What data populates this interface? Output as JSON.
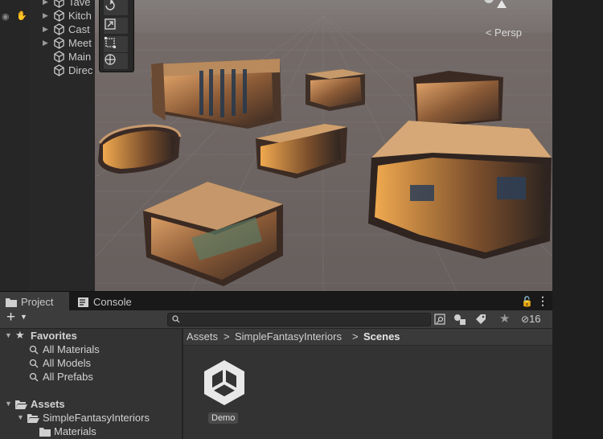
{
  "hierarchy": {
    "items": [
      {
        "label": "Tave",
        "has_children": true
      },
      {
        "label": "Kitch",
        "has_children": true
      },
      {
        "label": "Cast",
        "has_children": true
      },
      {
        "label": "Meet",
        "has_children": true
      },
      {
        "label": "Main",
        "has_children": false
      },
      {
        "label": "Direc",
        "has_children": false
      }
    ]
  },
  "scene": {
    "projection_label": "Persp",
    "tools": [
      "rotate-tool",
      "scale-tool",
      "rect-tool",
      "transform-tool"
    ]
  },
  "bottom_panel": {
    "tabs": [
      {
        "label": "Project",
        "icon": "folder-icon",
        "active": true
      },
      {
        "label": "Console",
        "icon": "console-icon",
        "active": false
      }
    ],
    "add_label": "+",
    "search": {
      "value": "",
      "placeholder": ""
    },
    "hidden_packages_count": "16",
    "favorites": {
      "label": "Favorites",
      "items": [
        "All Materials",
        "All Models",
        "All Prefabs"
      ]
    },
    "assets_tree": {
      "label": "Assets",
      "children": [
        {
          "label": "SimpleFantasyInteriors"
        },
        {
          "label": "Materials"
        }
      ]
    },
    "breadcrumb": [
      "Assets",
      "SimpleFantasyInteriors",
      "Scenes"
    ],
    "assets": [
      {
        "name": "Demo",
        "icon": "unity-scene-icon"
      }
    ]
  },
  "colors": {
    "panel": "#333333",
    "tab_bar": "#191919",
    "toolbar": "#3c3c3c",
    "scene_floor": "#6f6664",
    "scene_sky": "#8a8786"
  }
}
